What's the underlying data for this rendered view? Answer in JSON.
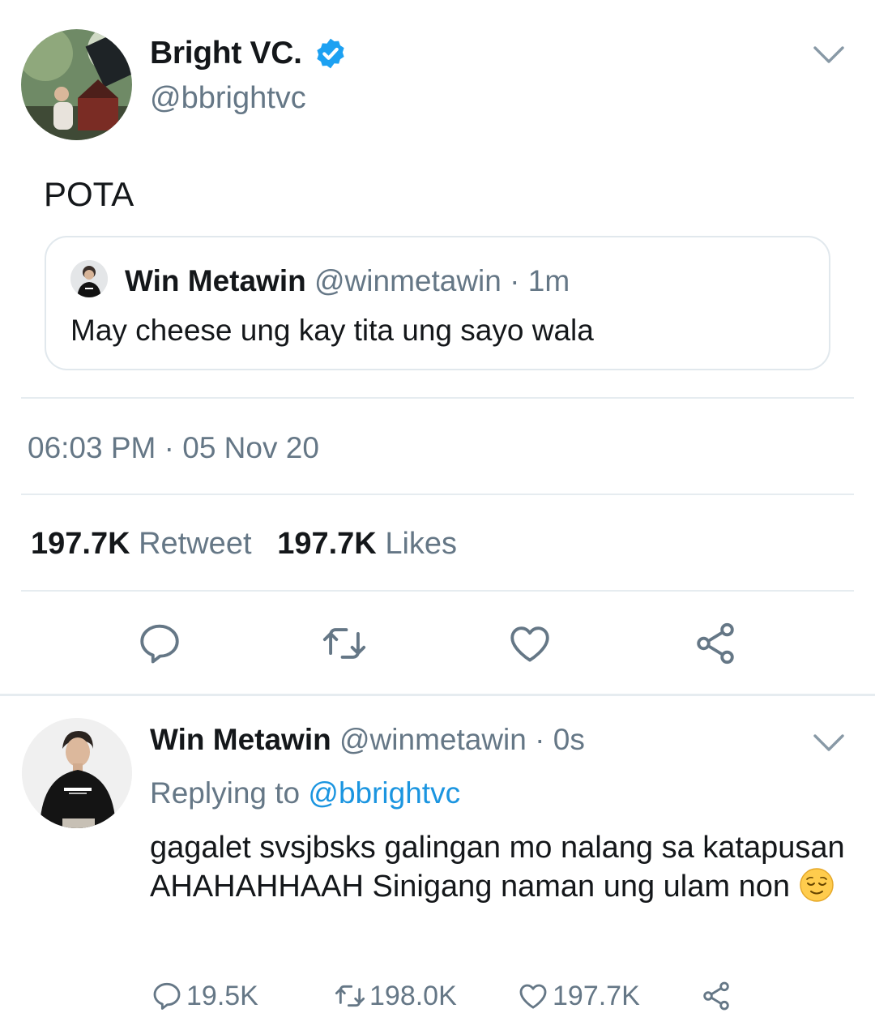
{
  "tweet": {
    "author_name": "Bright VC.",
    "author_handle": "@bbrightvc",
    "text": "POTA",
    "timestamp": "06:03 PM · 05 Nov 20",
    "quote": {
      "author_name": "Win Metawin",
      "author_handle": "@winmetawin",
      "time": "· 1m",
      "text": "May cheese ung kay tita ung sayo wala"
    },
    "stats": {
      "retweet_count": "197.7K",
      "retweet_label": "Retweet",
      "likes_count": "197.7K",
      "likes_label": "Likes"
    },
    "actions": [
      "reply-icon",
      "retweet-icon",
      "like-icon",
      "share-icon"
    ]
  },
  "reply": {
    "author_name": "Win Metawin",
    "author_handle": "@winmetawin",
    "time": "· 0s",
    "replying_label": "Replying to",
    "replying_handle": "@bbrightvc",
    "text": "gagalet svsjbsks galingan mo nalang  sa katapusan AHAHAHHAAH Sinigang naman ung ulam non",
    "counts": {
      "replies": "19.5K",
      "retweets": "198.0K",
      "likes": "197.7K"
    }
  },
  "colors": {
    "text": "#14171a",
    "muted": "#657786",
    "link": "#1b95e0",
    "divider": "#e6ecf0",
    "verified": "#1da1f2"
  }
}
